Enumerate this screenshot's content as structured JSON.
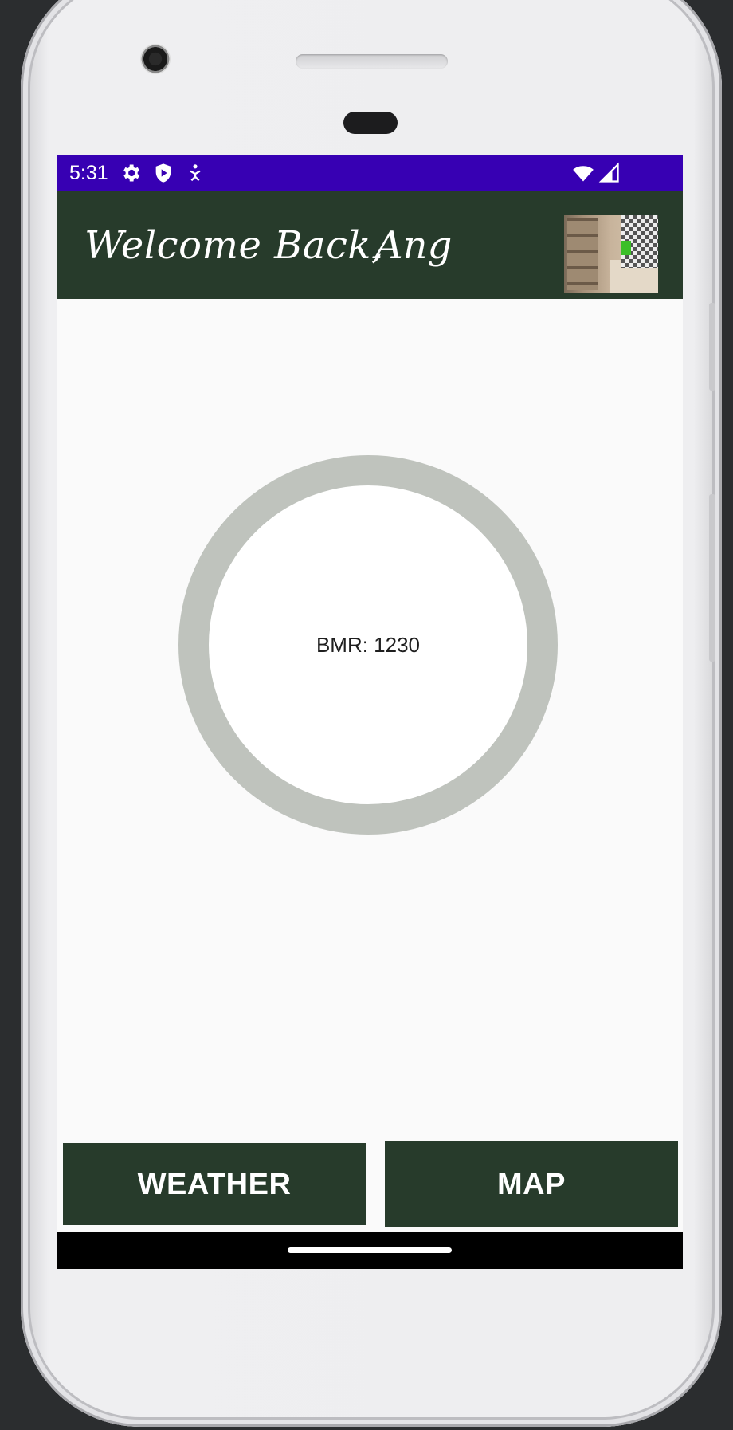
{
  "status_bar": {
    "time": "5:31",
    "left_icons": [
      "gear-icon",
      "shield-play-icon",
      "accessibility-icon"
    ],
    "right_icons": [
      "wifi-icon",
      "cell-signal-icon"
    ],
    "background": "#3700b3"
  },
  "app_bar": {
    "greeting": "Welcome Back,",
    "username": "Ang",
    "background": "#273b2b"
  },
  "bmr": {
    "label": "BMR: 1230",
    "ring_color": "#bfc3bd"
  },
  "buttons": {
    "weather_label": "WEATHER",
    "map_label": "MAP",
    "background": "#273b2b"
  }
}
